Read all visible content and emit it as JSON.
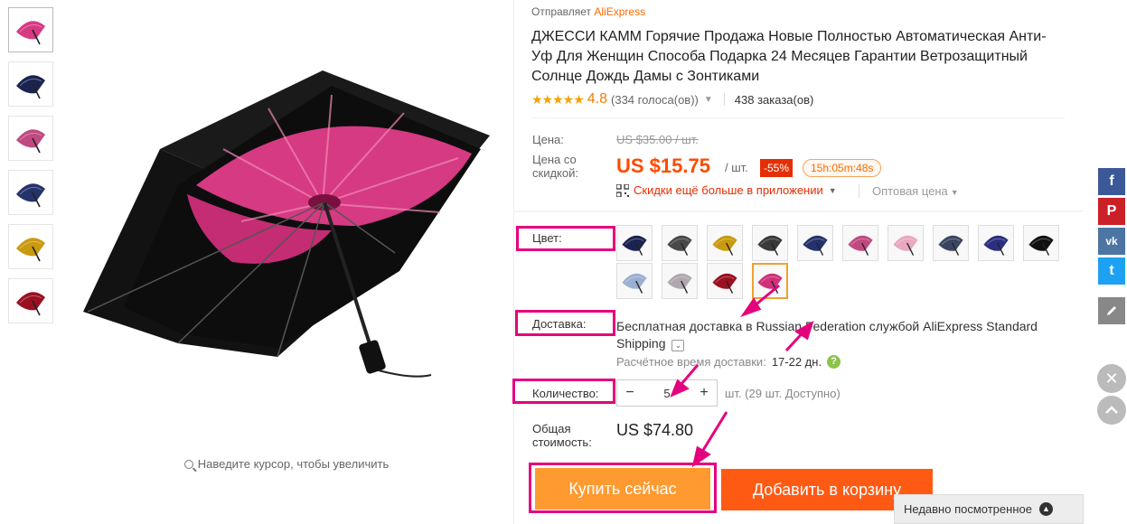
{
  "gallery": {
    "thumbnails": [
      "umbrella-pink-flower",
      "umbrella-navy",
      "umbrella-pink",
      "umbrella-blue-star",
      "umbrella-yellow-flower",
      "umbrella-red"
    ],
    "zoom_hint": "Наведите курсор, чтобы увеличить"
  },
  "product": {
    "seller_prefix": "Отправляет",
    "seller_name": "AliExpress",
    "title": "ДЖЕССИ КАММ Горячие Продажа Новые Полностью Автоматическая Анти-Уф Для Женщин Способа Подарка 24 Месяцев Гарантии Ветрозащитный Солнце Дождь Дамы с Зонтиками",
    "stars": "★★★★★",
    "rating": "4.8",
    "votes": "(334 голоса(ов))",
    "orders": "438 заказа(ов)"
  },
  "price": {
    "label_price": "Цена:",
    "old_price": "US $35.00 / шт.",
    "label_discount_1": "Цена со",
    "label_discount_2": "скидкой:",
    "new_price": "US $15.75",
    "per_unit": "/ шт.",
    "discount": "-55%",
    "timer": "15h:05m:48s",
    "app_deal": "Скидки ещё больше в приложении",
    "wholesale": "Оптовая цена"
  },
  "options": {
    "color_label": "Цвет:",
    "swatch_colors": [
      "#1b2450",
      "#4a4a4a",
      "#c99a10",
      "#3a3a3a",
      "#25336b",
      "#c04a80",
      "#e8a8c0",
      "#3a4560",
      "#2a2f80",
      "#111111",
      "#9ab0d0",
      "#b0a8b0",
      "#9a1020",
      "#d0307a"
    ],
    "selected_index": 13,
    "delivery_label": "Доставка:",
    "delivery_text": "Бесплатная доставка в Russian Federation службой AliExpress Standard Shipping",
    "delivery_toggle": "⌄",
    "eta_label": "Расчётное время доставки:",
    "eta_days": "17-22 дн.",
    "eta_help": "?",
    "qty_label": "Количество:",
    "qty_minus": "−",
    "qty_value": "5",
    "qty_plus": "+",
    "qty_note": "шт. (29 шт. Доступно)",
    "total_label_1": "Общая",
    "total_label_2": "стоимость:",
    "total_value": "US $74.80"
  },
  "actions": {
    "buy_now": "Купить сейчас",
    "add_to_cart": "Добавить в корзину",
    "recently_viewed": "Недавно посмотренное",
    "recently_viewed_icon": "chevron-up-icon"
  },
  "social": {
    "facebook": "f",
    "pinterest": "P",
    "vk": "vk",
    "twitter": "t",
    "edit_icon": "pencil-icon",
    "close_icon": "close-icon",
    "top_icon": "chevron-up-icon"
  },
  "colors": {
    "accent_pink": "#e5007d",
    "price_orange": "#ff4a00",
    "buy_orange": "#ff9a30",
    "cart_orange": "#ff5a14"
  }
}
